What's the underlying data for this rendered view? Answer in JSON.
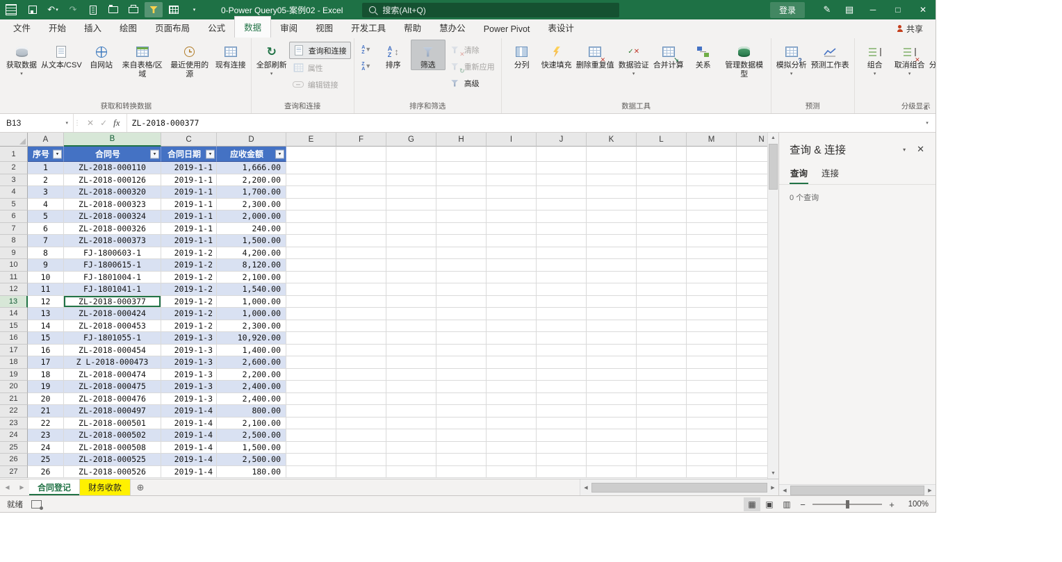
{
  "titlebar": {
    "title": "0-Power Query05-案例02 - Excel",
    "search": "搜索(Alt+Q)",
    "sign_in": "登录"
  },
  "icons": {
    "dropdown": "▾",
    "undo": "↶",
    "redo": "↷",
    "refresh": "↻",
    "check": "✓",
    "x": "✕",
    "minimize": "─",
    "maximize": "□",
    "close": "✕",
    "pen": "✎",
    "ribbon_display": "▤",
    "left": "◀",
    "right": "▶",
    "up": "▲",
    "down": "▼",
    "plus_circle": "⊕",
    "plus": "+",
    "minus": "−",
    "collapse": "∧",
    "launcher": "↘",
    "sum": "Σ",
    "updown": "↕",
    "question": "?",
    "handle": "⋮",
    "view_normal": "▦",
    "view_layout": "▣",
    "view_break": "▥"
  },
  "ribbon": {
    "tabs": [
      "文件",
      "开始",
      "插入",
      "绘图",
      "页面布局",
      "公式",
      "数据",
      "审阅",
      "视图",
      "开发工具",
      "帮助",
      "慧办公",
      "Power Pivot",
      "表设计"
    ],
    "tab_keys": [
      "file",
      "home",
      "insert",
      "draw",
      "page-layout",
      "formulas",
      "data",
      "review",
      "view",
      "developer",
      "help",
      "huibangong",
      "power-pivot",
      "table-design"
    ],
    "active_tab": "数据",
    "share": "共享",
    "g1": {
      "label": "获取和转换数据",
      "b1": "获取数据",
      "b2": "从文本/CSV",
      "b3": "自网站",
      "b4": "来自表格/区域",
      "b5": "最近使用的源",
      "b6": "现有连接"
    },
    "g2": {
      "label": "查询和连接",
      "b1": "全部刷新",
      "b2": "查询和连接",
      "b3": "属性",
      "b4": "编辑链接"
    },
    "g3": {
      "label": "排序和筛选",
      "b1": "排序",
      "b2": "筛选",
      "b3": "清除",
      "b4": "重新应用",
      "b5": "高级"
    },
    "g4": {
      "label": "数据工具",
      "b1": "分列",
      "b2": "快速填充",
      "b3": "删除重复值",
      "b4": "数据验证",
      "b5": "合并计算",
      "b6": "关系",
      "b7": "管理数据模型"
    },
    "g5": {
      "label": "预测",
      "b1": "模拟分析",
      "b2": "预测工作表"
    },
    "g6": {
      "label": "分级显示",
      "b1": "组合",
      "b2": "取消组合",
      "b3": "分类汇总"
    }
  },
  "formula_bar": {
    "name_box": "B13",
    "fx": "fx",
    "value": "ZL-2018-000377"
  },
  "sheet": {
    "columns": [
      "A",
      "B",
      "C",
      "D",
      "E",
      "F",
      "G",
      "H",
      "I",
      "J",
      "K",
      "L",
      "M",
      "N"
    ],
    "row_count": 27,
    "row_header_width": 40,
    "col_widths": {
      "A": 52,
      "B": 140,
      "C": 80,
      "D": 100,
      "default": 72
    },
    "selected_cell": {
      "col": "B",
      "row": 13
    },
    "table": {
      "range_cols": [
        "A",
        "B",
        "C",
        "D"
      ],
      "headers": [
        "序号",
        "合同号",
        "合同日期",
        "应收金额"
      ],
      "rows": [
        [
          "1",
          "ZL-2018-000110",
          "2019-1-1",
          "1,666.00"
        ],
        [
          "2",
          "ZL-2018-000126",
          "2019-1-1",
          "2,200.00"
        ],
        [
          "3",
          "ZL-2018-000320",
          "2019-1-1",
          "1,700.00"
        ],
        [
          "4",
          "ZL-2018-000323",
          "2019-1-1",
          "2,300.00"
        ],
        [
          "5",
          "ZL-2018-000324",
          "2019-1-1",
          "2,000.00"
        ],
        [
          "6",
          "ZL-2018-000326",
          "2019-1-1",
          "240.00"
        ],
        [
          "7",
          "ZL-2018-000373",
          "2019-1-1",
          "1,500.00"
        ],
        [
          "8",
          "FJ-1800603-1",
          "2019-1-2",
          "4,200.00"
        ],
        [
          "9",
          "FJ-1800615-1",
          "2019-1-2",
          "8,120.00"
        ],
        [
          "10",
          "FJ-1801004-1",
          "2019-1-2",
          "2,100.00"
        ],
        [
          "11",
          "FJ-1801041-1",
          "2019-1-2",
          "1,540.00"
        ],
        [
          "12",
          "ZL-2018-000377",
          "2019-1-2",
          "1,000.00"
        ],
        [
          "13",
          "ZL-2018-000424",
          "2019-1-2",
          "1,000.00"
        ],
        [
          "14",
          "ZL-2018-000453",
          "2019-1-2",
          "2,300.00"
        ],
        [
          "15",
          "FJ-1801055-1",
          "2019-1-3",
          "10,920.00"
        ],
        [
          "16",
          "ZL-2018-000454",
          "2019-1-3",
          "1,400.00"
        ],
        [
          "17",
          "Z L-2018-000473",
          "2019-1-3",
          "2,600.00"
        ],
        [
          "18",
          "ZL-2018-000474",
          "2019-1-3",
          "2,200.00"
        ],
        [
          "19",
          "ZL-2018-000475",
          "2019-1-3",
          "2,400.00"
        ],
        [
          "20",
          "ZL-2018-000476",
          "2019-1-3",
          "2,400.00"
        ],
        [
          "21",
          "ZL-2018-000497",
          "2019-1-4",
          "800.00"
        ],
        [
          "22",
          "ZL-2018-000501",
          "2019-1-4",
          "2,100.00"
        ],
        [
          "23",
          "ZL-2018-000502",
          "2019-1-4",
          "2,500.00"
        ],
        [
          "24",
          "ZL-2018-000508",
          "2019-1-4",
          "1,500.00"
        ],
        [
          "25",
          "ZL-2018-000525",
          "2019-1-4",
          "2,500.00"
        ],
        [
          "26",
          "ZL-2018-000526",
          "2019-1-4",
          "180.00"
        ]
      ]
    }
  },
  "task_pane": {
    "title": "查询 & 连接",
    "tab_queries": "查询",
    "tab_connections": "连接",
    "empty": "0 个查询"
  },
  "sheet_tabs": {
    "tabs": [
      {
        "name": "合同登记",
        "active": true
      },
      {
        "name": "财务收款",
        "active": false,
        "color": "#FFF100"
      }
    ]
  },
  "status_bar": {
    "ready": "就绪",
    "zoom_level": "100%"
  },
  "colors": {
    "excel_green": "#1E7145",
    "accent_green": "#217346",
    "table_header_blue": "#4472C4",
    "row_band_blue": "#D9E1F2",
    "sheet_tab_yellow": "#FFF100"
  }
}
